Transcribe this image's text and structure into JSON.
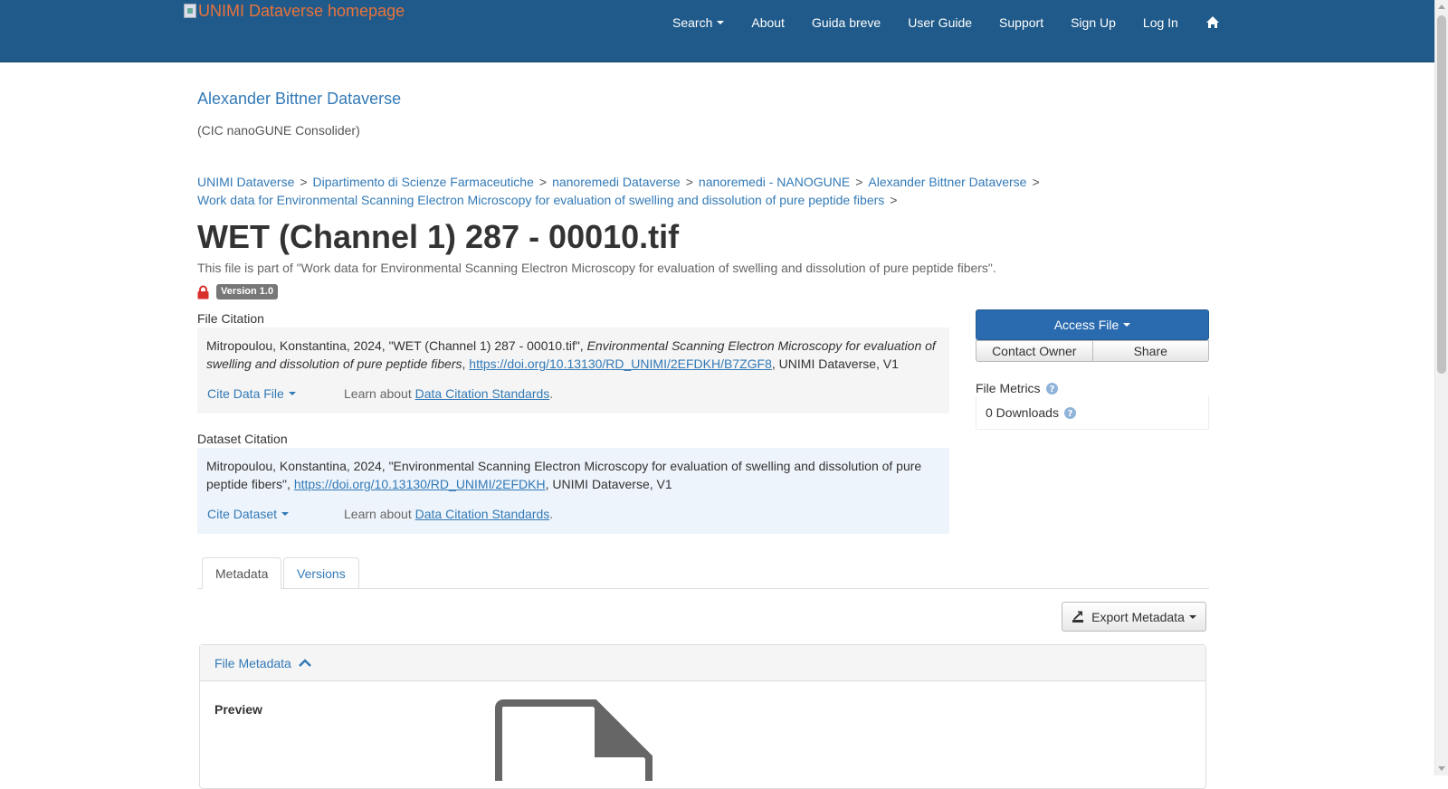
{
  "navbar": {
    "brand_alt": "UNIMI Dataverse homepage",
    "items": [
      "Search",
      "About",
      "Guida breve",
      "User Guide",
      "Support",
      "Sign Up",
      "Log In"
    ],
    "home_icon": "home-icon",
    "bg_color": "#1f5a8a"
  },
  "header": {
    "dataverse_title": "Alexander Bittner Dataverse",
    "affiliation": "(CIC nanoGUNE Consolider)"
  },
  "breadcrumbs": [
    "UNIMI Dataverse",
    "Dipartimento di Scienze Farmaceutiche",
    "nanoremedi Dataverse",
    "nanoremedi - NANOGUNE",
    "Alexander Bittner Dataverse",
    "Work data for Environmental Scanning Electron Microscopy for evaluation of swelling and dissolution of pure peptide fibers"
  ],
  "breadcrumb_sep": ">",
  "file": {
    "title": "WET (Channel 1) 287 - 00010.tif",
    "part_of": "This file is part of \"Work data for Environmental Scanning Electron Microscopy for evaluation of swelling and dissolution of pure peptide fibers\".",
    "version": "Version 1.0"
  },
  "file_citation": {
    "label": "File Citation",
    "prefix": "Mitropoulou, Konstantina, 2024, \"WET (Channel 1) 287 - 00010.tif\", ",
    "dataset_italic": "Environmental Scanning Electron Microscopy for evaluation of swelling and dissolution of pure peptide fibers",
    "comma": ", ",
    "doi": "https://doi.org/10.13130/RD_UNIMI/2EFDKH/B7ZGF8",
    "suffix": ", UNIMI Dataverse, V1",
    "cite_dropdown": "Cite Data File",
    "learn_prefix": "Learn about ",
    "learn_link": "Data Citation Standards",
    "learn_suffix": "."
  },
  "dataset_citation": {
    "label": "Dataset Citation",
    "prefix": "Mitropoulou, Konstantina, 2024, \"Environmental Scanning Electron Microscopy for evaluation of swelling and dissolution of pure peptide fibers\", ",
    "doi": "https://doi.org/10.13130/RD_UNIMI/2EFDKH",
    "suffix": ", UNIMI Dataverse, V1",
    "cite_dropdown": "Cite Dataset",
    "learn_prefix": "Learn about ",
    "learn_link": "Data Citation Standards",
    "learn_suffix": "."
  },
  "actions": {
    "access_file": "Access File",
    "contact_owner": "Contact Owner",
    "share": "Share"
  },
  "metrics": {
    "label": "File Metrics",
    "downloads": "0 Downloads"
  },
  "tabs": [
    "Metadata",
    "Versions"
  ],
  "export": {
    "label": "Export Metadata"
  },
  "metadata_panel": {
    "heading": "File Metadata",
    "preview_label": "Preview"
  }
}
